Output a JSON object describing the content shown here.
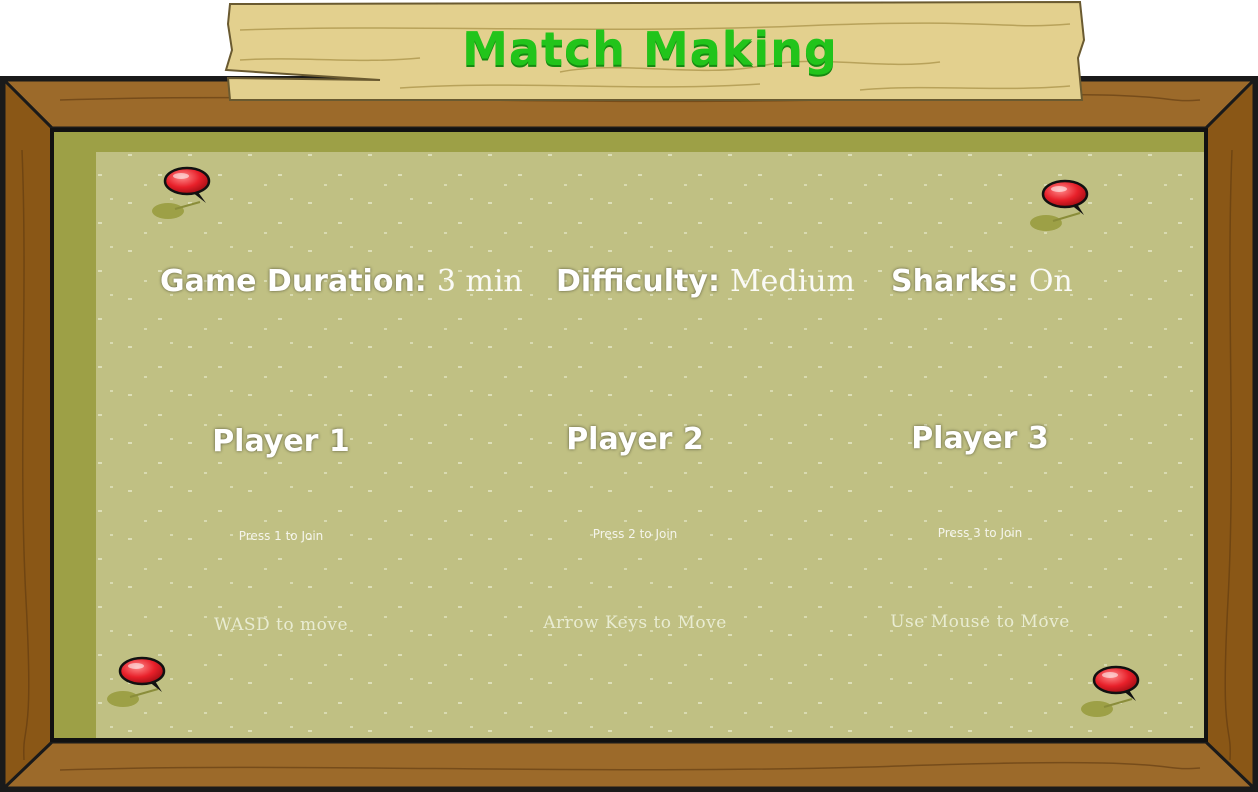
{
  "sign": {
    "title": "Match Making"
  },
  "settings": {
    "duration": {
      "label": "Game Duration:",
      "value": "3 min"
    },
    "difficulty": {
      "label": "Difficulty:",
      "value": "Medium"
    },
    "sharks": {
      "label": "Sharks:",
      "value": "On"
    }
  },
  "players": [
    {
      "title": "Player 1",
      "join": "Press 1 to Join",
      "controls": "WASD to move"
    },
    {
      "title": "Player 2",
      "join": "Press 2 to Join",
      "controls": "Arrow Keys to Move"
    },
    {
      "title": "Player 3",
      "join": "Press 3 to Join",
      "controls": "Use Mouse to Move"
    }
  ],
  "colors": {
    "title_green": "#22c41b",
    "frame_brown": "#8b5a1c",
    "board_olive": "#c0c083",
    "pin_red": "#e8202a"
  },
  "icons": [
    "push-pin-icon"
  ]
}
